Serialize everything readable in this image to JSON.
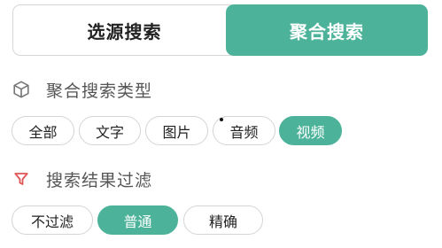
{
  "buttons": {
    "source_search": "选源搜索",
    "aggregate_search": "聚合搜索"
  },
  "search_type": {
    "title": "聚合搜索类型",
    "icon": "cube-icon",
    "options": [
      "全部",
      "文字",
      "图片",
      "音频",
      "视频"
    ],
    "selected": "视频"
  },
  "result_filter": {
    "title": "搜索结果过滤",
    "icon": "funnel-icon",
    "options": [
      "不过滤",
      "普通",
      "精确"
    ],
    "selected": "普通"
  },
  "colors": {
    "accent": "#4cb39a",
    "filter_icon": "#e05555",
    "border": "#d4d4d4"
  }
}
